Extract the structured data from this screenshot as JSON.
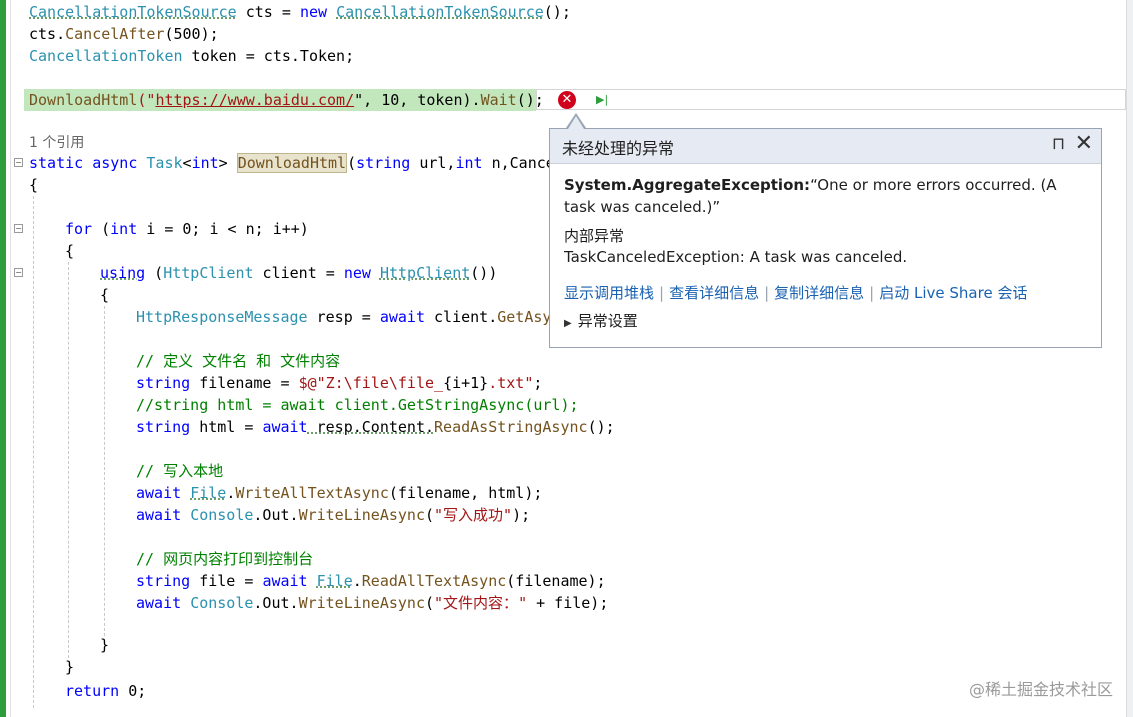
{
  "code": {
    "l1": {
      "t1": "CancellationTokenSource",
      "t2": " cts = ",
      "kw": "new",
      "t3": " ",
      "t4": "CancellationTokenSource",
      "t5": "();"
    },
    "l2": {
      "t1": "cts.",
      "m": "CancelAfter",
      "t2": "(500);"
    },
    "l3": {
      "t1": "CancellationToken",
      "t2": " token = cts.Token;"
    },
    "l4": {
      "m": "DownloadHtml",
      "t1": "(\"",
      "url": "https://www.baidu.com/",
      "t2": "\", 10, token).",
      "m2": "Wait",
      "t3": "();"
    },
    "refcount": "1 个引用",
    "l5": {
      "kw1": "static",
      "kw2": "async",
      "ty": "Task",
      "t1": "<",
      "kw3": "int",
      "t2": "> ",
      "m": "DownloadHtml",
      "t3": "(",
      "kw4": "string",
      "t4": " url,",
      "kw5": "int",
      "t5": " n,",
      "t6": "Cance"
    },
    "l6": "{",
    "l7": {
      "kw1": "for",
      "t1": " (",
      "kw2": "int",
      "t2": " i = 0; i < n; i++)"
    },
    "l8": "{",
    "l9": {
      "kw1": "using",
      "t1": " (",
      "ty1": "HttpClient",
      "t2": " client = ",
      "kw2": "new",
      "t3": " ",
      "ty2": "HttpClient",
      "t4": "())"
    },
    "l10": "{",
    "l11": {
      "ty": "HttpResponseMessage",
      "t1": " resp = ",
      "kw": "await",
      "t2": " client.",
      "m": "GetAsy"
    },
    "l12": "// 定义 文件名 和 文件内容",
    "l13": {
      "kw": "string",
      "t1": " filename = ",
      "s": "$@\"Z:\\file\\file_",
      "t2": "{i+1}",
      "s2": ".txt\"",
      "t3": ";"
    },
    "l14": "//string html = await client.GetStringAsync(url);",
    "l15": {
      "kw1": "string",
      "t1": " html = ",
      "kw2": "await",
      "t2": " resp.Content.",
      "m": "ReadAsStringAsync",
      "t3": "();"
    },
    "l16": "// 写入本地",
    "l17": {
      "kw": "await",
      "t1": " ",
      "ty": "File",
      "t2": ".",
      "m": "WriteAllTextAsync",
      "t3": "(filename, html);"
    },
    "l18": {
      "kw": "await",
      "t1": " ",
      "ty": "Console",
      "t2": ".Out.",
      "m": "WriteLineAsync",
      "t3": "(",
      "s": "\"写入成功\"",
      "t4": ");"
    },
    "l19": "// 网页内容打印到控制台",
    "l20": {
      "kw1": "string",
      "t1": " file = ",
      "kw2": "await",
      "t2": " ",
      "ty": "File",
      "t3": ".",
      "m": "ReadAllTextAsync",
      "t4": "(filename);"
    },
    "l21": {
      "kw": "await",
      "t1": " ",
      "ty": "Console",
      "t2": ".Out.",
      "m": "WriteLineAsync",
      "t3": "(",
      "s": "\"文件内容：\"",
      "t4": " + file);"
    },
    "l22": "}",
    "l23": "}",
    "l24": {
      "kw": "return",
      "t1": " 0;"
    }
  },
  "popup": {
    "title": "未经处理的异常",
    "exception_type": "System.AggregateException:",
    "exception_message": "“One or more errors occurred. (A task was canceled.)”",
    "inner_title": "内部异常",
    "inner_message": "TaskCanceledException: A task was canceled.",
    "links": [
      "显示调用堆栈",
      "查看详细信息",
      "复制详细信息",
      "启动 Live Share 会话"
    ],
    "settings_label": "异常设置"
  },
  "icons": {
    "error": "error-circle-icon",
    "next": "run-to-cursor-icon",
    "pin": "pin-icon",
    "close": "close-icon"
  },
  "watermark": "@稀土掘金技术社区"
}
